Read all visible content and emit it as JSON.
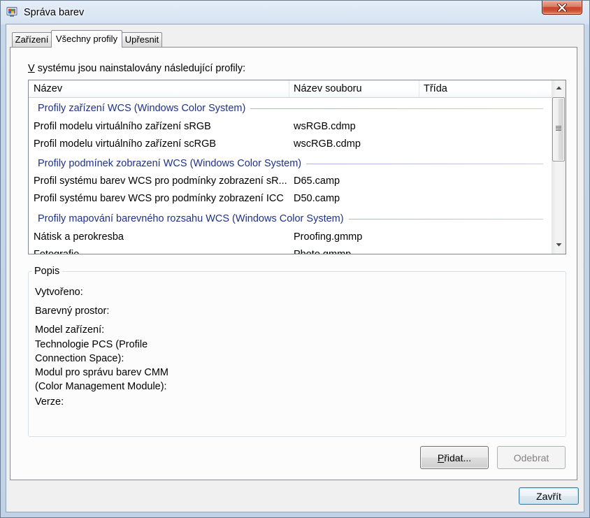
{
  "window": {
    "title": "Správa barev"
  },
  "icons": {
    "app": "color-management-icon",
    "close": "close-icon",
    "scroll_up": "scroll-up-arrow-icon",
    "scroll_down": "scroll-down-arrow-icon",
    "scroll_grip": "scrollbar-grip-icon"
  },
  "tabs": [
    {
      "label": "Zařízení",
      "selected": false
    },
    {
      "label": "Všechny profily",
      "selected": true
    },
    {
      "label": "Upřesnit",
      "selected": false
    }
  ],
  "profiles": {
    "caption": "V systému jsou nainstalovány následující profily:",
    "columns": {
      "name": "Název",
      "file": "Název souboru",
      "class": "Třída"
    },
    "groups": [
      {
        "title": "Profily zařízení WCS (Windows Color System)",
        "rows": [
          {
            "name": "Profil modelu virtuálního zařízení sRGB",
            "file": "wsRGB.cdmp"
          },
          {
            "name": "Profil modelu virtuálního zařízení scRGB",
            "file": "wscRGB.cdmp"
          }
        ]
      },
      {
        "title": "Profily podmínek zobrazení WCS (Windows Color System)",
        "rows": [
          {
            "name": "Profil systému barev WCS pro podmínky zobrazení sR...",
            "file": "D65.camp"
          },
          {
            "name": "Profil systému barev WCS pro podmínky zobrazení ICC",
            "file": "D50.camp"
          }
        ]
      },
      {
        "title": "Profily mapování barevného rozsahu WCS (Windows Color System)",
        "rows": [
          {
            "name": "Nátisk a perokresba",
            "file": "Proofing.gmmp"
          },
          {
            "name": "Fotografie",
            "file": "Photo.gmmp"
          }
        ]
      }
    ]
  },
  "description": {
    "title": "Popis",
    "fields": {
      "created": "Vytvořeno:",
      "color_space": "Barevný prostor:",
      "device_model": "Model zařízení:",
      "pcs": [
        "Technologie PCS (Profile",
        "Connection Space):"
      ],
      "cmm": [
        "Modul pro správu barev CMM",
        "(Color Management Module):"
      ],
      "version": "Verze:"
    }
  },
  "buttons": {
    "add": {
      "label": "Přidat...",
      "enabled": true
    },
    "remove": {
      "label": "Odebrat",
      "enabled": false
    },
    "close": {
      "label": "Zavřít",
      "default": true
    }
  },
  "colors": {
    "group_header": "#1e3287",
    "disabled_text": "#838383",
    "close_button": "#c8442b",
    "default_button_border": "#3c7fb1"
  }
}
